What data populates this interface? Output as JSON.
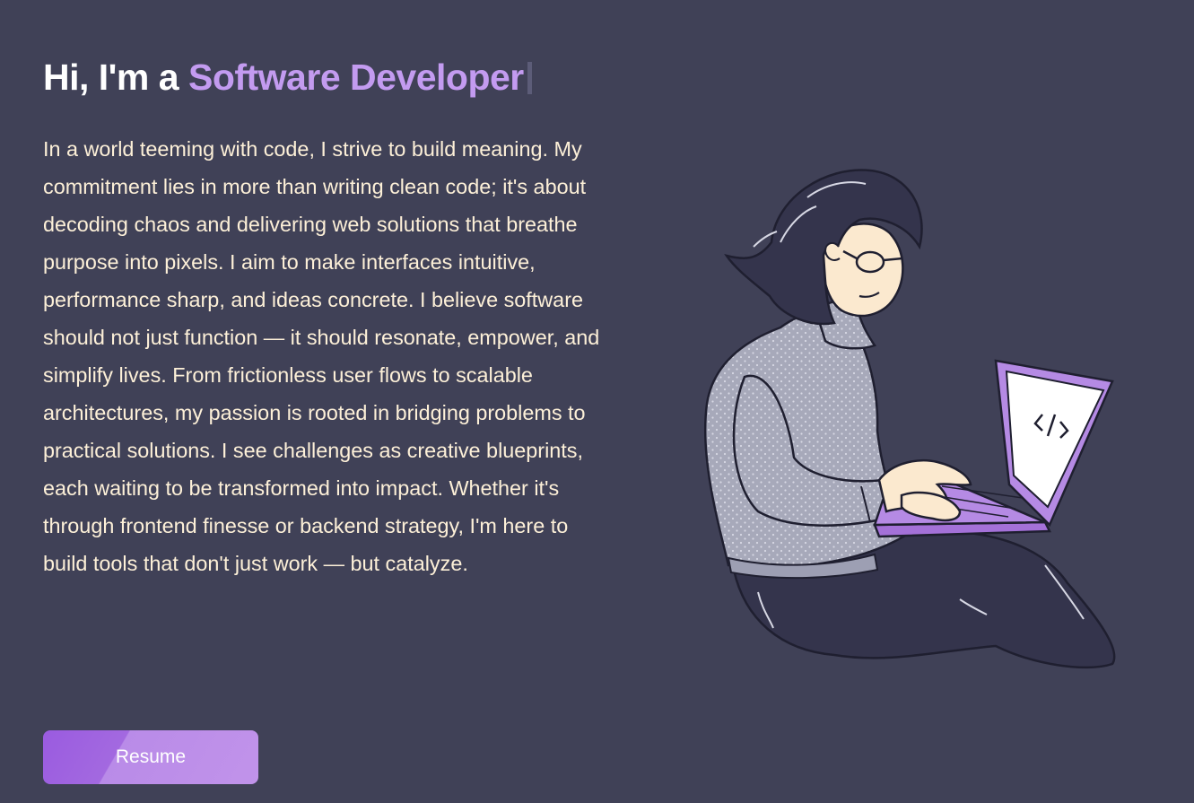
{
  "hero": {
    "greeting": "Hi, I'm a ",
    "role": "Software Developer",
    "bio": "In a world teeming with code, I strive to build meaning. My commitment lies in more than writing clean code; it's about decoding chaos and delivering web solutions that breathe purpose into pixels. I aim to make interfaces intuitive, performance sharp, and ideas concrete. I believe software should not just function — it should resonate, empower, and simplify lives. From frictionless user flows to scalable architectures, my passion is rooted in bridging problems to practical solutions. I see challenges as creative blueprints, each waiting to be transformed into impact. Whether it's through frontend finesse or backend strategy, I'm here to build tools that don't just work — but catalyze.",
    "resume_label": "Resume"
  },
  "illustration": {
    "subject": "developer-with-laptop",
    "screen_glyph": "</>"
  },
  "colors": {
    "background": "#404157",
    "accent": "#c39bf0",
    "body_text": "#fdf0d8",
    "button_start": "#9a5be0",
    "button_end": "#c193ea"
  }
}
